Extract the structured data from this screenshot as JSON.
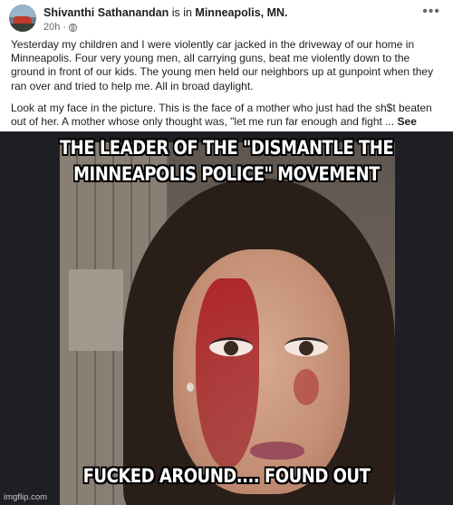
{
  "post": {
    "author": "Shivanthi Sathanandan",
    "location_prefix": "is in",
    "location": "Minneapolis, MN.",
    "time": "20h",
    "more_icon": "ellipsis-icon",
    "paragraph1": "Yesterday my children and I were violently  car jacked in the driveway of our home in Minneapolis. Four very young men, all carrying guns, beat me violently down to the ground in front of our kids. The young men held our neighbors up at gunpoint when they ran over and tried to help me. All in broad daylight.",
    "paragraph2": "Look at my face in the picture. This is the face of a mother who just had the sh$t beaten out of her. A mother whose only thought was, \"let me run far enough and fight ...",
    "see_more": "See more"
  },
  "meme": {
    "top_text": "THE LEADER OF THE \"DISMANTLE THE MINNEAPOLIS POLICE\" MOVEMENT",
    "bottom_text": "FUCKED AROUND.... FOUND OUT",
    "watermark": "imgflip.com"
  }
}
